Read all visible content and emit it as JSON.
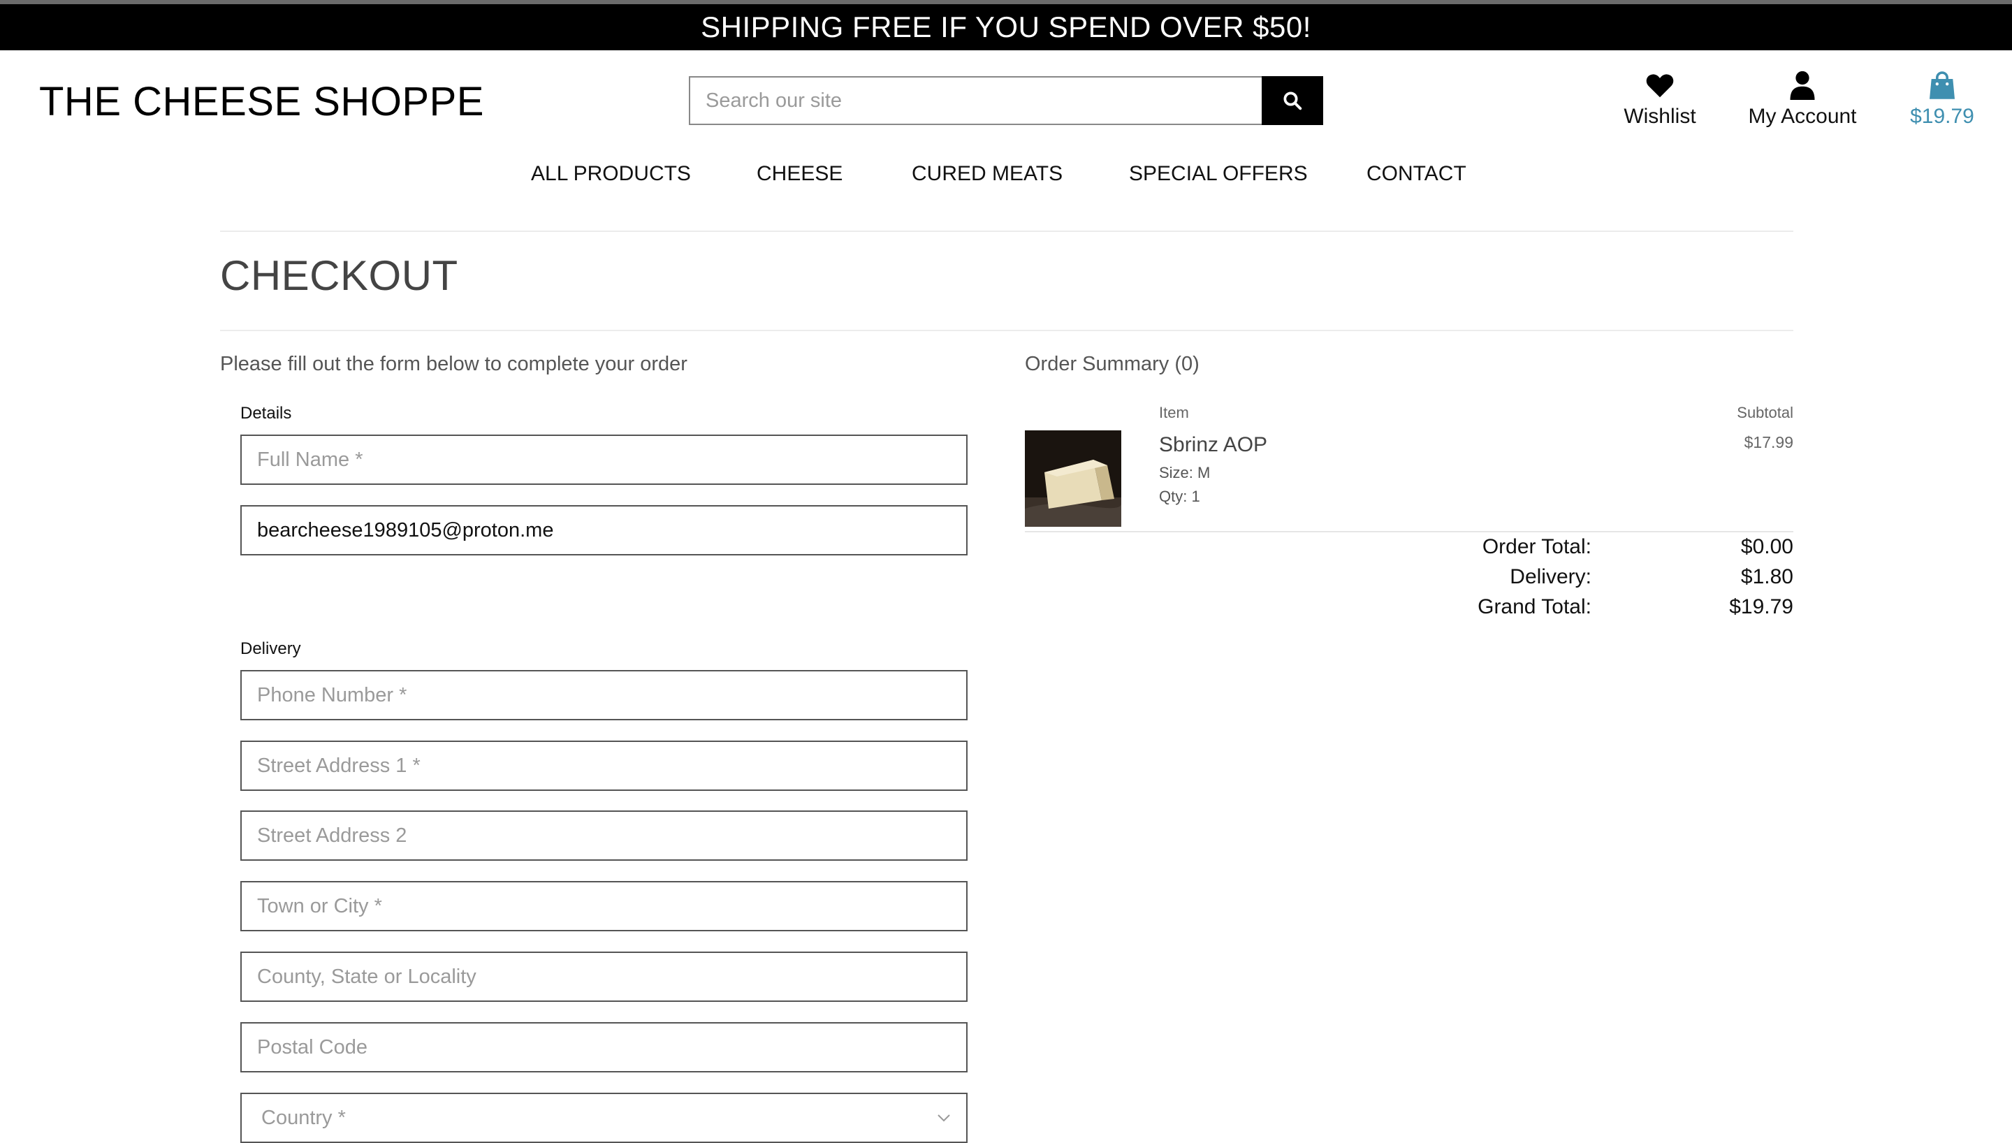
{
  "banner": {
    "text": "SHIPPING FREE IF YOU SPEND OVER $50!"
  },
  "header": {
    "logo": "THE CHEESE SHOPPE",
    "search_placeholder": "Search our site",
    "wishlist_label": "Wishlist",
    "account_label": "My Account",
    "bag_total": "$19.79",
    "bag_color": "#3f8fb0"
  },
  "nav": {
    "items": [
      "ALL PRODUCTS",
      "CHEESE",
      "CURED MEATS",
      "SPECIAL OFFERS",
      "CONTACT"
    ]
  },
  "page": {
    "title": "CHECKOUT",
    "intro": "Please fill out the form below to complete your order"
  },
  "form": {
    "details_label": "Details",
    "full_name_placeholder": "Full Name *",
    "email_value": "bearcheese1989105@proton.me",
    "delivery_label": "Delivery",
    "phone_placeholder": "Phone Number *",
    "street1_placeholder": "Street Address 1 *",
    "street2_placeholder": "Street Address 2",
    "town_placeholder": "Town or City *",
    "county_placeholder": "County, State or Locality",
    "postcode_placeholder": "Postal Code",
    "country_selected": "Country *"
  },
  "summary": {
    "title": "Order Summary (0)",
    "col_item": "Item",
    "col_subtotal": "Subtotal",
    "product": {
      "name": "Sbrinz AOP",
      "size": "Size: M",
      "qty": "Qty: 1",
      "price": "$17.99"
    },
    "order_total_label": "Order Total:",
    "order_total_value": "$0.00",
    "delivery_label": "Delivery:",
    "delivery_value": "$1.80",
    "grand_total_label": "Grand Total:",
    "grand_total_value": "$19.79"
  },
  "icons": {
    "search": "search-icon",
    "wishlist": "heart-icon",
    "account": "user-icon",
    "bag": "shopping-bag-icon",
    "country_dropdown": "chevron-down-icon"
  }
}
